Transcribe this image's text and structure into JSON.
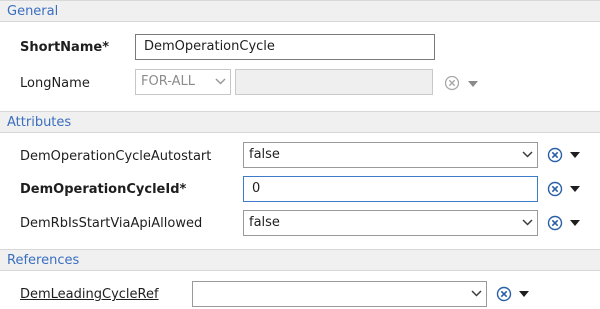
{
  "sections": {
    "general": "General",
    "attributes": "Attributes",
    "references": "References"
  },
  "general": {
    "short_name_label": "ShortName*",
    "short_name_value": "DemOperationCycle",
    "long_name_label": "LongName",
    "long_name_lang": "FOR-ALL",
    "long_name_value": ""
  },
  "attributes": {
    "autostart_label": "DemOperationCycleAutostart",
    "autostart_value": "false",
    "cycle_id_label": "DemOperationCycleId*",
    "cycle_id_value": "0",
    "start_via_api_label": "DemRbIsStartViaApiAllowed",
    "start_via_api_value": "false"
  },
  "references": {
    "leading_cycle_label": "DemLeadingCycleRef",
    "leading_cycle_value": ""
  },
  "colors": {
    "section_text": "#3a6ebf",
    "section_bg": "#f0f0f0",
    "focus_border": "#3d7bc9",
    "icon_blue": "#2a5fa8"
  },
  "icons": [
    "remove-value-icon",
    "dropdown-arrow-icon"
  ]
}
